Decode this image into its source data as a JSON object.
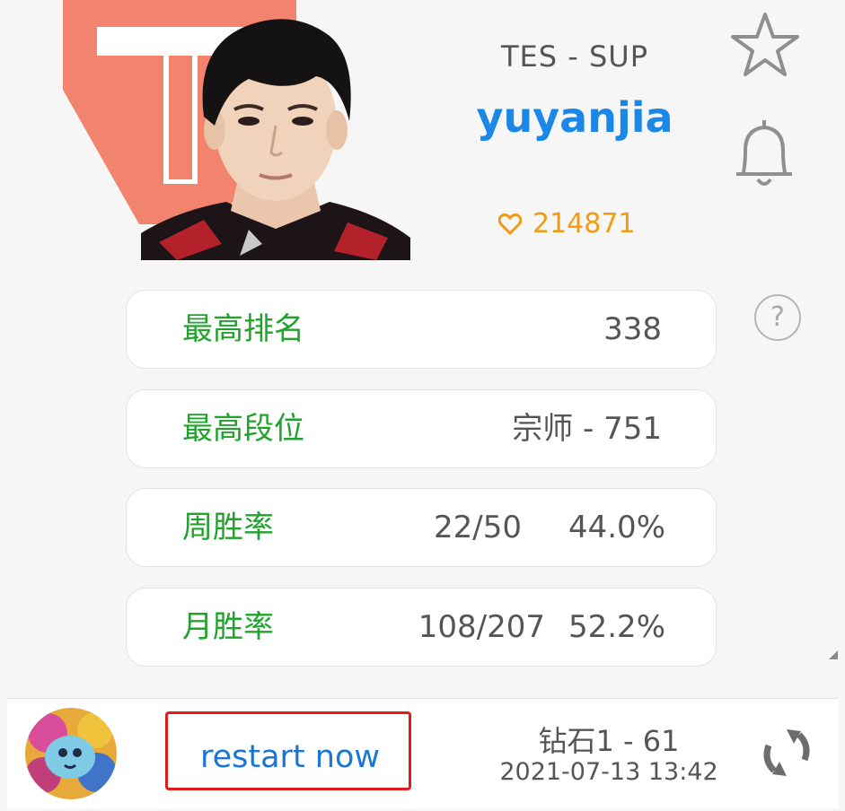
{
  "header": {
    "team_role": "TES - SUP",
    "player_name": "yuyanjia",
    "likes": "214871"
  },
  "stats": [
    {
      "label": "最高排名",
      "value": "338"
    },
    {
      "label": "最高段位",
      "value": "宗师 - 751"
    },
    {
      "label": "周胜率",
      "value": "22/50",
      "value2": "44.0%"
    },
    {
      "label": "月胜率",
      "value": "108/207",
      "value2": "52.2%"
    }
  ],
  "help_icon": "?",
  "footer": {
    "restart_label": "restart now",
    "rank": "钻石1 - 61",
    "updated": "2021-07-13 13:42"
  },
  "colors": {
    "name_blue": "#1b88e8",
    "label_green": "#1fa32b",
    "like_orange": "#f39b12",
    "team_logo": "#f07e6e",
    "highlight_red": "#e21c1c"
  },
  "icons": [
    "star-icon",
    "bell-icon",
    "heart-icon",
    "help-icon",
    "refresh-icon"
  ]
}
